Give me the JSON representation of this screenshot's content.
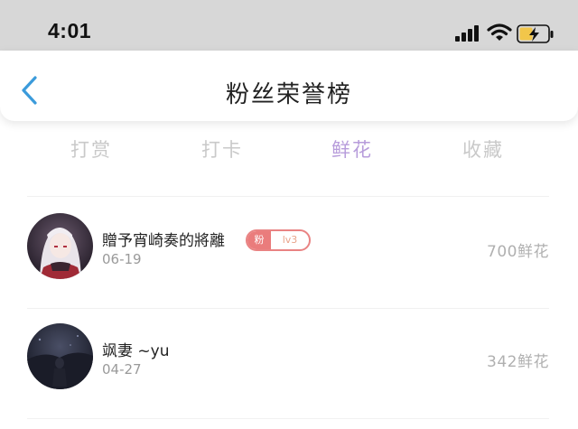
{
  "status_bar": {
    "time": "4:01",
    "icons": [
      "signal-icon",
      "wifi-icon",
      "battery-charging-icon"
    ]
  },
  "header": {
    "back_icon": "chevron-left-icon",
    "title": "粉丝荣誉榜"
  },
  "tabs": [
    {
      "label": "打赏",
      "active": false
    },
    {
      "label": "打卡",
      "active": false
    },
    {
      "label": "鲜花",
      "active": true
    },
    {
      "label": "收藏",
      "active": false
    }
  ],
  "list": [
    {
      "name": "贈予宵崎奏的將離",
      "date": "06-19",
      "badge": {
        "label": "粉",
        "level": "lv3"
      },
      "count": "700鲜花"
    },
    {
      "name": "飒妻 ~yu",
      "date": "04-27",
      "count": "342鲜花"
    }
  ],
  "colors": {
    "status_bar_bg": "#d7d7d7",
    "accent_tab": "#b79cdb",
    "inactive_tab": "#c9c9c9",
    "back_arrow": "#3b9bdb",
    "badge": "#ea7c7c"
  }
}
